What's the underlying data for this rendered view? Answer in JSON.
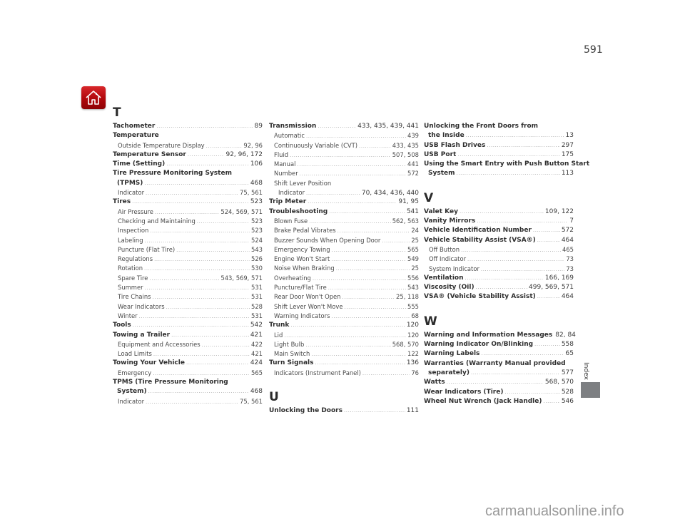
{
  "page": {
    "number": "591",
    "section_tab": "Index",
    "home_icon": "home-icon",
    "watermark": "carmanualsonline.info"
  },
  "columns": [
    {
      "blocks": [
        {
          "letter": "T",
          "entries": [
            {
              "level": 0,
              "label": "Tachometer",
              "pages": "89"
            },
            {
              "level": "h",
              "label": "Temperature"
            },
            {
              "level": 1,
              "label": "Outside Temperature Display",
              "pages": "92, 96"
            },
            {
              "level": 0,
              "label": "Temperature Sensor",
              "pages": "92, 96, 172"
            },
            {
              "level": 0,
              "label": "Time (Setting)",
              "pages": "106"
            },
            {
              "level": "h",
              "label": "Tire Pressure Monitoring System"
            },
            {
              "level": "c",
              "label": "(TPMS)",
              "pages": "468"
            },
            {
              "level": 1,
              "label": "Indicator",
              "pages": "75, 561"
            },
            {
              "level": 0,
              "label": "Tires",
              "pages": "523"
            },
            {
              "level": 1,
              "label": "Air Pressure",
              "pages": "524, 569, 571"
            },
            {
              "level": 1,
              "label": "Checking and Maintaining",
              "pages": "523"
            },
            {
              "level": 1,
              "label": "Inspection",
              "pages": "523"
            },
            {
              "level": 1,
              "label": "Labeling",
              "pages": "524"
            },
            {
              "level": 1,
              "label": "Puncture (Flat Tire)",
              "pages": "543"
            },
            {
              "level": 1,
              "label": "Regulations",
              "pages": "526"
            },
            {
              "level": 1,
              "label": "Rotation",
              "pages": "530"
            },
            {
              "level": 1,
              "label": "Spare Tire",
              "pages": "543, 569, 571"
            },
            {
              "level": 1,
              "label": "Summer",
              "pages": "531"
            },
            {
              "level": 1,
              "label": "Tire Chains",
              "pages": "531"
            },
            {
              "level": 1,
              "label": "Wear Indicators",
              "pages": "528"
            },
            {
              "level": 1,
              "label": "Winter",
              "pages": "531"
            },
            {
              "level": 0,
              "label": "Tools",
              "pages": "542"
            },
            {
              "level": 0,
              "label": "Towing a Trailer",
              "pages": "421"
            },
            {
              "level": 1,
              "label": "Equipment and Accessories",
              "pages": "422"
            },
            {
              "level": 1,
              "label": "Load Limits",
              "pages": "421"
            },
            {
              "level": 0,
              "label": "Towing Your Vehicle",
              "pages": "424"
            },
            {
              "level": 1,
              "label": "Emergency",
              "pages": "565"
            },
            {
              "level": "h",
              "label": "TPMS (Tire Pressure Monitoring"
            },
            {
              "level": "c",
              "label": "System)",
              "pages": "468"
            },
            {
              "level": 1,
              "label": "Indicator",
              "pages": "75, 561"
            }
          ]
        }
      ]
    },
    {
      "blocks": [
        {
          "letter": "",
          "entries": [
            {
              "level": 0,
              "label": "Transmission",
              "pages": "433, 435, 439, 441"
            },
            {
              "level": 1,
              "label": "Automatic",
              "pages": "439"
            },
            {
              "level": 1,
              "label": "Continuously Variable (CVT)",
              "pages": "433, 435"
            },
            {
              "level": 1,
              "label": "Fluid",
              "pages": "507, 508"
            },
            {
              "level": 1,
              "label": "Manual",
              "pages": "441"
            },
            {
              "level": 1,
              "label": "Number",
              "pages": "572"
            },
            {
              "level": "s",
              "label": "Shift Lever Position"
            },
            {
              "level": 2,
              "label": "Indicator",
              "pages": "70, 434, 436, 440"
            },
            {
              "level": 0,
              "label": "Trip Meter",
              "pages": "91, 95"
            },
            {
              "level": 0,
              "label": "Troubleshooting",
              "pages": "541"
            },
            {
              "level": 1,
              "label": "Blown Fuse",
              "pages": "562, 563"
            },
            {
              "level": 1,
              "label": "Brake Pedal Vibrates",
              "pages": "24"
            },
            {
              "level": 1,
              "label": "Buzzer Sounds When Opening Door",
              "pages": "25"
            },
            {
              "level": 1,
              "label": "Emergency Towing",
              "pages": "565"
            },
            {
              "level": 1,
              "label": "Engine Won't Start",
              "pages": "549"
            },
            {
              "level": 1,
              "label": "Noise When Braking",
              "pages": "25"
            },
            {
              "level": 1,
              "label": "Overheating",
              "pages": "556"
            },
            {
              "level": 1,
              "label": "Puncture/Flat Tire",
              "pages": "543"
            },
            {
              "level": 1,
              "label": "Rear Door Won't Open",
              "pages": "25, 118"
            },
            {
              "level": 1,
              "label": "Shift Lever Won't Move",
              "pages": "555"
            },
            {
              "level": 1,
              "label": "Warning Indicators",
              "pages": "68"
            },
            {
              "level": 0,
              "label": "Trunk",
              "pages": "120"
            },
            {
              "level": 1,
              "label": "Lid",
              "pages": "120"
            },
            {
              "level": 1,
              "label": "Light Bulb",
              "pages": "568, 570"
            },
            {
              "level": 1,
              "label": "Main Switch",
              "pages": "122"
            },
            {
              "level": 0,
              "label": "Turn Signals",
              "pages": "136"
            },
            {
              "level": 1,
              "label": "Indicators (Instrument Panel)",
              "pages": "76"
            }
          ]
        },
        {
          "letter": "U",
          "entries": [
            {
              "level": 0,
              "label": "Unlocking the Doors",
              "pages": "111"
            }
          ]
        }
      ]
    },
    {
      "blocks": [
        {
          "letter": "",
          "entries": [
            {
              "level": "h",
              "label": "Unlocking the Front Doors from"
            },
            {
              "level": "c",
              "label": "the Inside",
              "pages": "13"
            },
            {
              "level": 0,
              "label": "USB Flash Drives",
              "pages": "297"
            },
            {
              "level": 0,
              "label": "USB Port",
              "pages": "175"
            },
            {
              "level": "h",
              "label": "Using the Smart Entry with Push Button Start"
            },
            {
              "level": "c",
              "label": "System",
              "pages": "113"
            }
          ]
        },
        {
          "letter": "V",
          "entries": [
            {
              "level": 0,
              "label": "Valet Key",
              "pages": "109, 122"
            },
            {
              "level": 0,
              "label": "Vanity Mirrors",
              "pages": "7"
            },
            {
              "level": 0,
              "label": "Vehicle Identification Number",
              "pages": "572"
            },
            {
              "level": 0,
              "label": "Vehicle Stability Assist (VSA®)",
              "pages": "464"
            },
            {
              "level": 1,
              "label": "Off Button",
              "pages": "465"
            },
            {
              "level": 1,
              "label": "Off Indicator",
              "pages": "73"
            },
            {
              "level": 1,
              "label": "System Indicator",
              "pages": "73"
            },
            {
              "level": 0,
              "label": "Ventilation",
              "pages": "166, 169"
            },
            {
              "level": 0,
              "label": "Viscosity (Oil)",
              "pages": "499, 569, 571"
            },
            {
              "level": 0,
              "label": "VSA® (Vehicle Stability Assist)",
              "pages": "464"
            }
          ]
        },
        {
          "letter": "W",
          "entries": [
            {
              "level": 0,
              "label": "Warning and Information Messages",
              "pages": "82, 84"
            },
            {
              "level": 0,
              "label": "Warning Indicator On/Blinking",
              "pages": "558"
            },
            {
              "level": 0,
              "label": "Warning Labels",
              "pages": "65"
            },
            {
              "level": "h",
              "label": "Warranties (Warranty Manual provided"
            },
            {
              "level": "c",
              "label": "separately)",
              "pages": "577"
            },
            {
              "level": 0,
              "label": "Watts",
              "pages": "568, 570"
            },
            {
              "level": 0,
              "label": "Wear Indicators (Tire)",
              "pages": "528"
            },
            {
              "level": 0,
              "label": "Wheel Nut Wrench (Jack Handle)",
              "pages": "546"
            }
          ]
        }
      ]
    }
  ]
}
